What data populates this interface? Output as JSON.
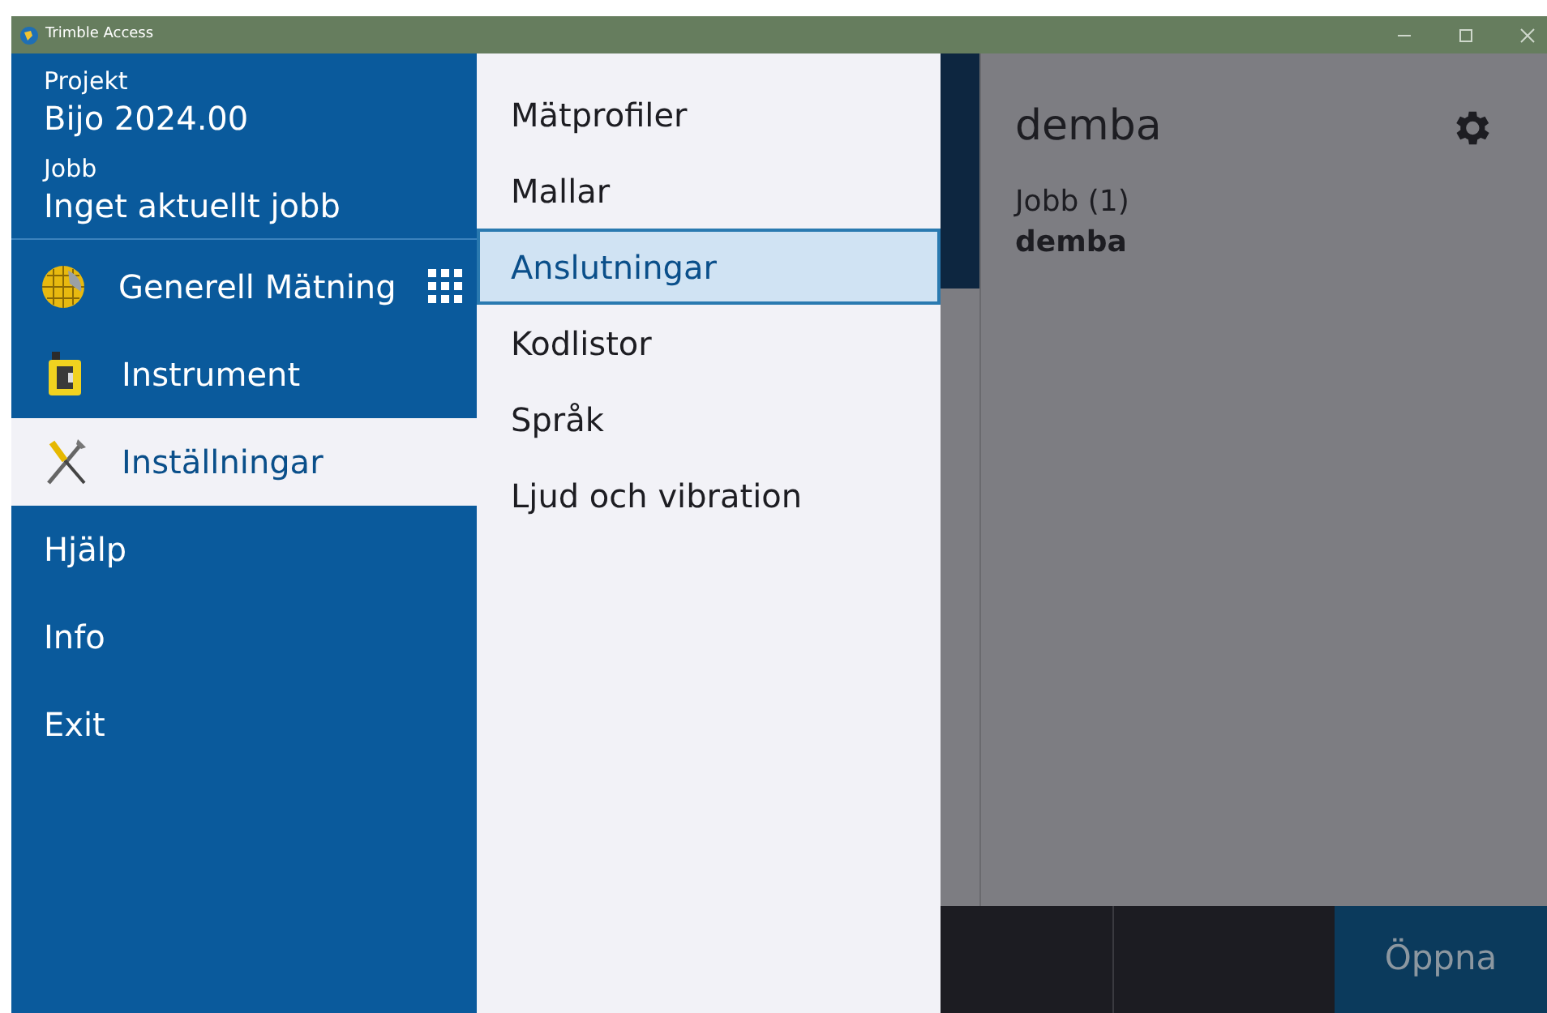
{
  "window": {
    "title": "Trimble Access"
  },
  "sidebar": {
    "project_label": "Projekt",
    "project": "Bijo 2024.00",
    "job_label": "Jobb",
    "job": "Inget aktuellt jobb",
    "items": [
      {
        "label": "Generell Mätning",
        "kind": "app",
        "selected": false
      },
      {
        "label": "Instrument",
        "kind": "instrument",
        "selected": false
      },
      {
        "label": "Inställningar",
        "kind": "settings",
        "selected": true
      },
      {
        "label": "Hjälp",
        "kind": "plain",
        "selected": false
      },
      {
        "label": "Info",
        "kind": "plain",
        "selected": false
      },
      {
        "label": "Exit",
        "kind": "plain",
        "selected": false
      }
    ]
  },
  "submenu": [
    {
      "label": "Mätprofiler",
      "selected": false
    },
    {
      "label": "Mallar",
      "selected": false
    },
    {
      "label": "Anslutningar",
      "selected": true
    },
    {
      "label": "Kodlistor",
      "selected": false
    },
    {
      "label": "Språk",
      "selected": false
    },
    {
      "label": "Ljud och vibration",
      "selected": false
    }
  ],
  "panel": {
    "title": "demba",
    "jobs_label": "Jobb (1)",
    "job": "demba"
  },
  "footer": {
    "open_button": {
      "label": "Öppna",
      "disabled": true
    }
  }
}
